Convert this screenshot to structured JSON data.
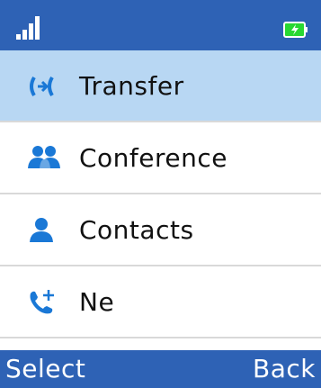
{
  "status": {
    "signal_icon": "signal-strength-icon",
    "battery_icon": "battery-charging-icon"
  },
  "menu": {
    "items": [
      {
        "label": "Transfer",
        "icon": "transfer-icon"
      },
      {
        "label": "Conference",
        "icon": "conference-icon"
      },
      {
        "label": "Contacts",
        "icon": "contacts-icon"
      },
      {
        "label": "Ne",
        "icon": "new-call-icon"
      }
    ]
  },
  "softkeys": {
    "left": "Select",
    "right": "Back"
  },
  "colors": {
    "bar_blue": "#2e62b5",
    "selected_bg": "#b8d7f3",
    "icon_blue": "#1a78d6",
    "battery_green": "#28d832"
  }
}
